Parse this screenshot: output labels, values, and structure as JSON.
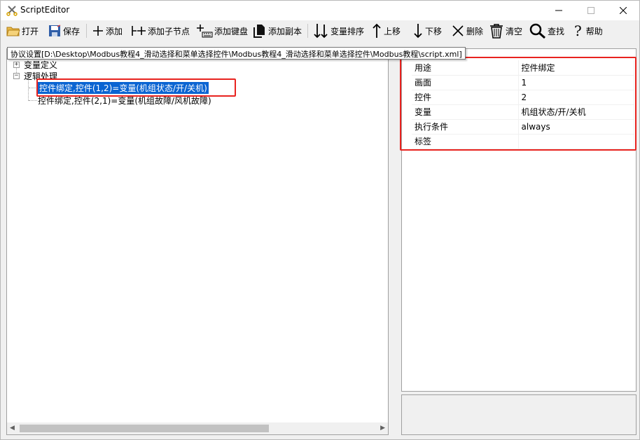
{
  "window": {
    "title": "ScriptEditor"
  },
  "toolbar": {
    "open": "打开",
    "save": "保存",
    "add": "添加",
    "add_child": "添加子节点",
    "add_keyboard": "添加键盘",
    "add_copy": "添加副本",
    "sort_vars": "变量排序",
    "move_up": "上移",
    "move_down": "下移",
    "delete": "删除",
    "clear": "清空",
    "find": "查找",
    "help": "帮助"
  },
  "path_tooltip": "协议设置[D:\\Desktop\\Modbus教程4_滑动选择和菜单选择控件\\Modbus教程4_滑动选择和菜单选择控件\\Modbus教程\\script.xml]",
  "tree": {
    "nodes": [
      {
        "label": "变量定义",
        "expander": "+"
      },
      {
        "label": "逻辑处理",
        "expander": "−"
      },
      {
        "label": "控件绑定,控件(1,2)=变量(机组状态/开/关机)"
      },
      {
        "label": "控件绑定,控件(2,1)=变量(机组故障/风机故障)"
      }
    ]
  },
  "properties": [
    {
      "key": "用途",
      "value": "控件绑定"
    },
    {
      "key": "画面",
      "value": "1"
    },
    {
      "key": "控件",
      "value": "2"
    },
    {
      "key": "变量",
      "value": "机组状态/开/关机"
    },
    {
      "key": "执行条件",
      "value": "always"
    },
    {
      "key": "标签",
      "value": ""
    }
  ],
  "colors": {
    "highlight": "#e8231f",
    "selection": "#0a64d2"
  }
}
